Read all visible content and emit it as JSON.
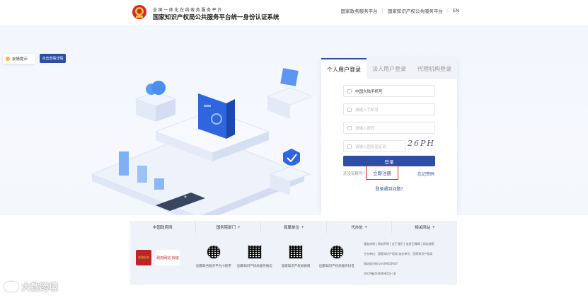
{
  "header": {
    "title_small": "全国一体化在线政务服务平台",
    "title_main": "国家知识产权局公共服务平台统一身份认证系统",
    "links": [
      "国家政务服务平台",
      "国家知识产权公共服务平台",
      "EN"
    ]
  },
  "notice": {
    "tag_label": "友情提示",
    "button_label": "点击查看详情"
  },
  "login": {
    "tabs": [
      "个人用户登录",
      "法人用户登录",
      "代理机构登录"
    ],
    "active_tab": 0,
    "phone_region": "中国大陆手机号",
    "account_placeholder": "请输入手机号",
    "password_placeholder": "请输入密码",
    "captcha_placeholder": "请输入图形验证码",
    "captcha_text": "26PH",
    "login_button": "登录",
    "no_account_text": "还没有账号？",
    "register_link": "立即注册",
    "forgot_link": "忘记密码",
    "problem_link": "登录遇到问题?"
  },
  "footer": {
    "nav": [
      "中国政府网",
      "国务院部门",
      "局属单位",
      "代办处",
      "相关网站"
    ],
    "badges": [
      "党政机关",
      "政府网站 找错"
    ],
    "qr_captions": [
      "国家政务服务平台小程序",
      "国家知识产权局服务微信",
      "国家知识产权局微博",
      "国家知识产权局服务抖音"
    ],
    "info_lines": [
      "服务热线 | 网站声明 | 关于我们 | 信息无障碍 | 网站地图",
      "主办单位：国家知识产权局 协办单位：国家知识产权局",
      "网站标识码 bm09000007",
      "京ICP备05069085号-18"
    ]
  },
  "watermark": {
    "text": "大数跨境"
  },
  "colors": {
    "primary": "#2c4ea5",
    "highlight_box": "#e02626",
    "hero_bg": "#f2f6fd"
  }
}
